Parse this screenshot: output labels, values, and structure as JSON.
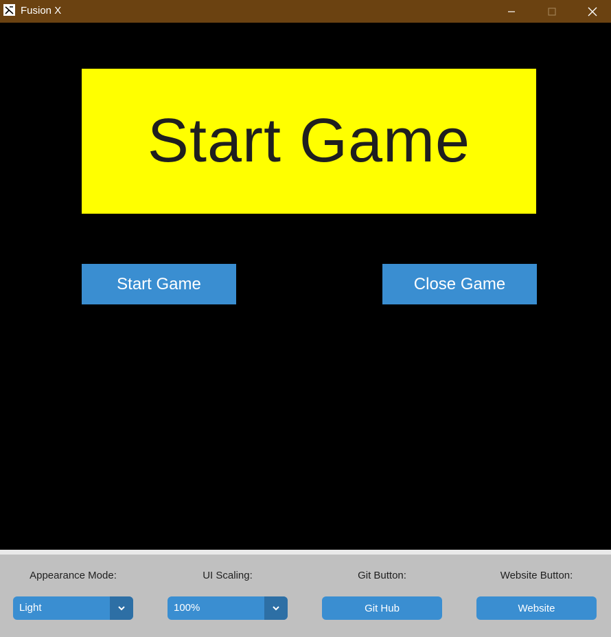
{
  "window": {
    "title": "Fusion X",
    "icon": "fusion-x-logo-icon"
  },
  "main": {
    "banner_text": "Start Game",
    "start_button": "Start Game",
    "close_button": "Close Game"
  },
  "settings": {
    "appearance": {
      "label": "Appearance Mode:",
      "value": "Light"
    },
    "scaling": {
      "label": "UI Scaling:",
      "value": "100%"
    },
    "git": {
      "label": "Git Button:",
      "button": "Git Hub"
    },
    "website": {
      "label": "Website Button:",
      "button": "Website"
    }
  },
  "colors": {
    "titlebar": "#6b4211",
    "banner": "#ffff00",
    "button": "#3a8ed1",
    "settings_bg": "#c0c0c0"
  }
}
